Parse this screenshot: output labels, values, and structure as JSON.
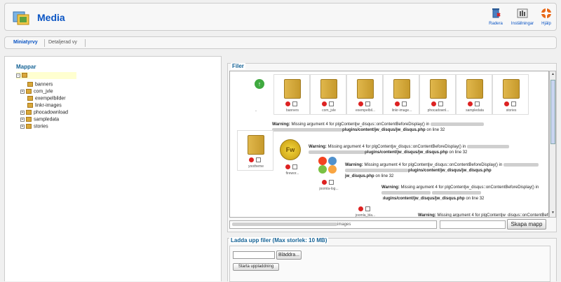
{
  "header": {
    "title": "Media",
    "buttons": [
      {
        "label": "Radera",
        "icon": "trash-icon"
      },
      {
        "label": "Inställningar",
        "icon": "settings-icon"
      },
      {
        "label": "Hjälp",
        "icon": "help-icon"
      }
    ]
  },
  "view_tabs": [
    "Miniatyrvy",
    "Detaljerad vy"
  ],
  "folders_panel": {
    "legend": "Mappar",
    "tree": [
      "banners",
      "com_jvle",
      "exempelbilder",
      "linkr-images",
      "phocadownload",
      "sampledata",
      "stories"
    ]
  },
  "files_panel": {
    "legend": "Filer",
    "items": [
      {
        "label": "..",
        "type": "up"
      },
      {
        "label": "banners",
        "type": "folder"
      },
      {
        "label": "com_jvle",
        "type": "folder"
      },
      {
        "label": "exempelbil...",
        "type": "folder"
      },
      {
        "label": "linkr-image...",
        "type": "folder"
      },
      {
        "label": "phocadownl...",
        "type": "folder"
      },
      {
        "label": "sampledata",
        "type": "folder"
      },
      {
        "label": "stories",
        "type": "folder"
      },
      {
        "label": "yootheme",
        "type": "folder"
      },
      {
        "label": "firewor...",
        "type": "image"
      },
      {
        "label": "joomla-log...",
        "type": "image"
      },
      {
        "label": "joomla_bla...",
        "type": "image"
      }
    ],
    "warning": {
      "prefix": "Warning:",
      "message": "Missing argument 4 for plgContentjw_disqus::onContentBeforeDisplay() in",
      "file": "plugins/content/jw_disqus/jw_disqus.php",
      "line_text": "on line 32"
    },
    "path_suffix": "images",
    "create_folder_button": "Skapa mapp"
  },
  "upload_panel": {
    "legend": "Ladda upp filer (Max storlek: 10 MB)",
    "browse_button": "Bläddra...",
    "start_button": "Starta uppladdning"
  }
}
